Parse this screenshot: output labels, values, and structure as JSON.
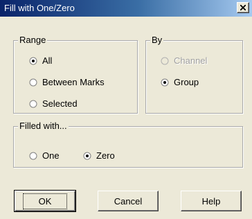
{
  "window": {
    "title": "Fill with One/Zero"
  },
  "range": {
    "legend": "Range",
    "options": [
      {
        "label": "All",
        "selected": true
      },
      {
        "label": "Between Marks",
        "selected": false
      },
      {
        "label": "Selected",
        "selected": false
      }
    ]
  },
  "by": {
    "legend": "By",
    "options": [
      {
        "label": "Channel",
        "selected": false,
        "disabled": true
      },
      {
        "label": "Group",
        "selected": true,
        "disabled": false
      }
    ]
  },
  "filled_with": {
    "legend": "Filled with...",
    "options": [
      {
        "label": "One",
        "selected": false
      },
      {
        "label": "Zero",
        "selected": true
      }
    ]
  },
  "buttons": {
    "ok": "OK",
    "cancel": "Cancel",
    "help": "Help"
  }
}
